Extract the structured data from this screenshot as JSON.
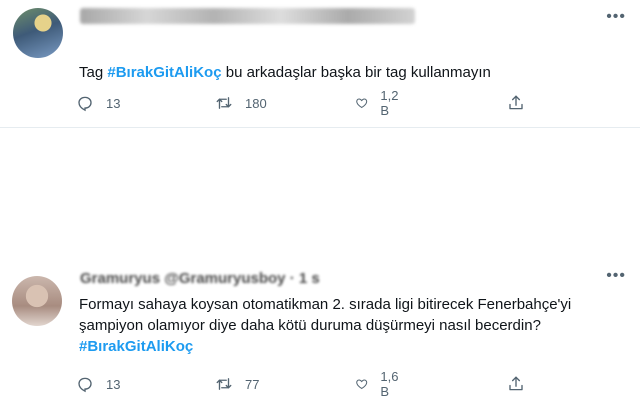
{
  "tweets": [
    {
      "author_blurred": true,
      "text_prefix": "Tag ",
      "hashtag": "#BırakGitAliKoç",
      "text_suffix": " bu arkadaşlar başka bir tag kullanmayın",
      "replies": "13",
      "retweets": "180",
      "likes": "1,2 B"
    },
    {
      "author_name_blurred": "Gramuryus @Gramuryusboy · 1 s",
      "line1": "Formayı sahaya koysan otomatikman 2. sırada ligi bitirecek Fenerbahçe'yi",
      "line2": "şampiyon olamıyor diye daha kötü duruma düşürmeyi nasıl becerdin?",
      "hashtag": "#BırakGitAliKoç",
      "replies": "13",
      "retweets": "77",
      "likes": "1,6 B"
    }
  ],
  "icons": {
    "reply": "reply-icon",
    "retweet": "retweet-icon",
    "like": "like-icon",
    "share": "share-icon",
    "more": "more-icon"
  },
  "colors": {
    "hashtag": "#1d9bf0",
    "meta": "#536471",
    "divider": "#e6ecf0"
  }
}
